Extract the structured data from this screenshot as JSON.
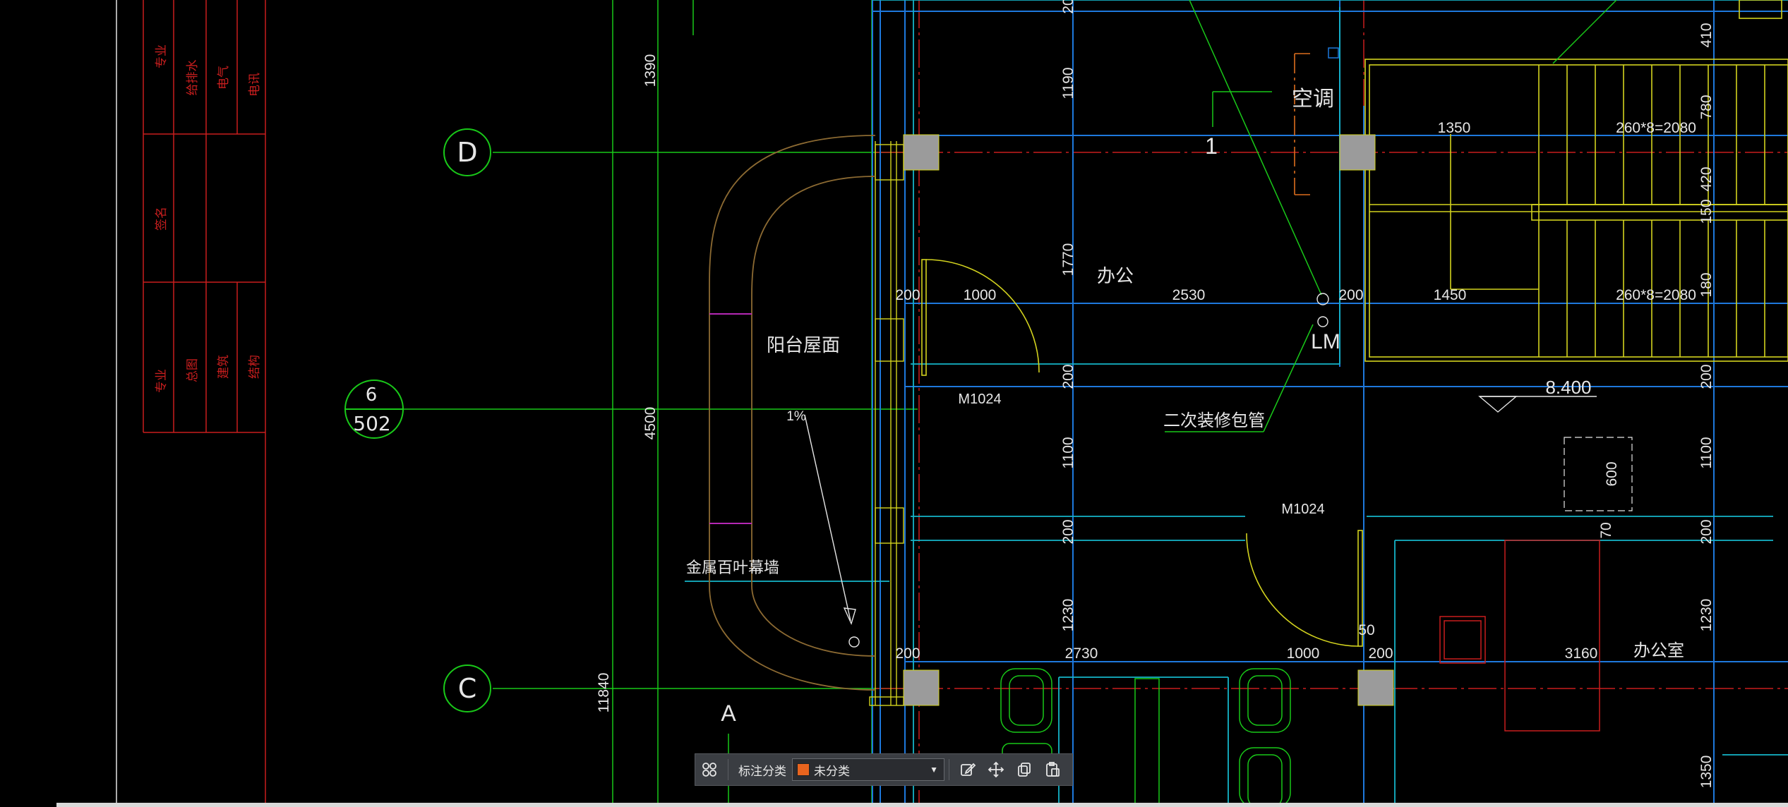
{
  "title_block": {
    "top_cells": [
      "专业",
      "给排水",
      "电气",
      "电讯"
    ],
    "mid_cell": "签名",
    "bottom_cells": [
      "专业",
      "总图",
      "建筑",
      "结构"
    ]
  },
  "axes": {
    "D": "D",
    "C": "C",
    "detail_num": "6",
    "detail_sheet": "502"
  },
  "labels": {
    "balcony_roof": "阳台屋面",
    "slope": "1%",
    "metal_louver": "金属百叶幕墙",
    "office": "办公",
    "air_con": "空调",
    "lm": "LM",
    "decor_pipe": "二次装修包管",
    "office_room": "办公室",
    "door_a": "M1024",
    "door_b": "M1024",
    "letter_a": "A",
    "num_1": "1",
    "elevation": "8.400"
  },
  "dims": {
    "v1390": "1390",
    "v4500": "4500",
    "v11840": "11840",
    "v1190": "1190",
    "v1770": "1770",
    "v200a": "200",
    "v1100": "1100",
    "v200b": "200",
    "v1230": "1230",
    "v20top": "20",
    "h200a": "200",
    "h1000a": "1000",
    "h2530": "2530",
    "h200b": "200",
    "h1450": "1450",
    "h1350": "1350",
    "stairs1": "260*8=2080",
    "stairs2": "260*8=2080",
    "h200c": "200",
    "h2730": "2730",
    "h1000b": "1000",
    "h200d": "200",
    "h3160": "3160",
    "h50": "50",
    "v600": "600",
    "v70": "70",
    "r410": "410",
    "r780": "780",
    "r420": "420",
    "r150": "150",
    "r180": "180",
    "r200a": "200",
    "r1100": "1100",
    "r200b": "200",
    "r1230": "1230",
    "r1350": "1350"
  },
  "toolbar": {
    "grid_icon": "grid-icon",
    "label": "标注分类",
    "select_value": "未分类",
    "swatch_color": "#e8641e",
    "edit_icon": "edit-icon",
    "move_icon": "move-icon",
    "copy_icon": "copy-icon",
    "paste_icon": "paste-icon"
  },
  "colors": {
    "background": "#000000",
    "axis_red": "#c81e1e",
    "grid_green": "#19c819",
    "wall_blue": "#1e78dc",
    "cyan": "#14b4c8",
    "yellow": "#d2d21e",
    "text": "#e6e6e6"
  }
}
